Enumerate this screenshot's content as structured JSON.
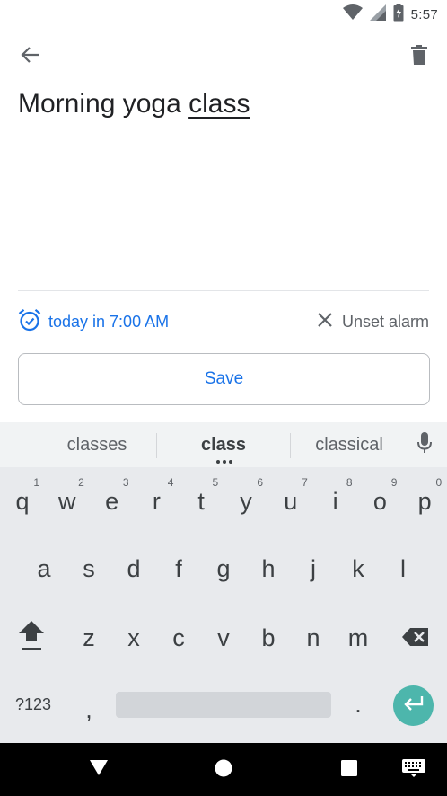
{
  "status_bar": {
    "time": "5:57",
    "icons": [
      "wifi-icon",
      "cell-signal-icon",
      "battery-charging-icon"
    ]
  },
  "app_bar": {
    "back_icon": "arrow-back-icon",
    "delete_icon": "trash-icon"
  },
  "note": {
    "title_prefix": "Morning yoga ",
    "title_underlined": "class"
  },
  "reminder": {
    "icon": "alarm-icon",
    "text": "today in 7:00 AM",
    "unset_icon": "close-icon",
    "unset_label": "Unset alarm"
  },
  "save_button": {
    "label": "Save"
  },
  "keyboard": {
    "suggestions": [
      "classes",
      "class",
      "classical"
    ],
    "row1": [
      {
        "key": "q",
        "hint": "1"
      },
      {
        "key": "w",
        "hint": "2"
      },
      {
        "key": "e",
        "hint": "3"
      },
      {
        "key": "r",
        "hint": "4"
      },
      {
        "key": "t",
        "hint": "5"
      },
      {
        "key": "y",
        "hint": "6"
      },
      {
        "key": "u",
        "hint": "7"
      },
      {
        "key": "i",
        "hint": "8"
      },
      {
        "key": "o",
        "hint": "9"
      },
      {
        "key": "p",
        "hint": "0"
      }
    ],
    "row2": [
      "a",
      "s",
      "d",
      "f",
      "g",
      "h",
      "j",
      "k",
      "l"
    ],
    "row3": [
      "z",
      "x",
      "c",
      "v",
      "b",
      "n",
      "m"
    ],
    "symbols_label": "?123",
    "comma": ",",
    "period": ".",
    "accent_color": "#4db6ac"
  },
  "colors": {
    "accent": "#1a73e8",
    "keyboard_bg": "#e8eaed"
  },
  "nav_bar": {
    "icons": [
      "back-triangle-icon",
      "home-circle-icon",
      "recents-square-icon",
      "keyboard-switch-icon"
    ]
  }
}
